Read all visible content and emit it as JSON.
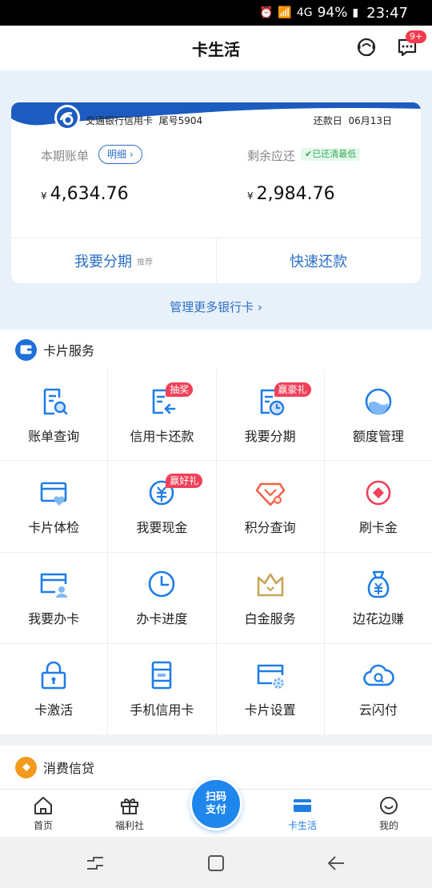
{
  "status_bar": {
    "battery": "94%",
    "time": "23:47",
    "network": "4G"
  },
  "header": {
    "title": "卡生活",
    "message_badge": "9+"
  },
  "card": {
    "bank_name": "交通银行信用卡",
    "tail_label": "尾号5904",
    "due_label": "还款日",
    "due_date": "06月13日",
    "current_bill_label": "本期账单",
    "detail_button": "明细 ›",
    "remaining_label": "剩余应还",
    "paid_status": "✔已还清最低",
    "currency": "¥",
    "current_bill_amount": "4,634.76",
    "remaining_amount": "2,984.76",
    "installment_action": "我要分期",
    "installment_tag": "推荐",
    "quick_pay_action": "快速还款"
  },
  "manage_link": "管理更多银行卡 ›",
  "sections": {
    "card_service": "卡片服务",
    "consumer_credit": "消费信贷"
  },
  "services": [
    {
      "label": "账单查询",
      "icon": "bill-query-icon",
      "tag": ""
    },
    {
      "label": "信用卡还款",
      "icon": "card-repay-icon",
      "tag": "抽奖"
    },
    {
      "label": "我要分期",
      "icon": "installment-icon",
      "tag": "赢豪礼"
    },
    {
      "label": "额度管理",
      "icon": "limit-manage-icon",
      "tag": ""
    },
    {
      "label": "卡片体检",
      "icon": "card-check-icon",
      "tag": ""
    },
    {
      "label": "我要现金",
      "icon": "cash-icon",
      "tag": "赢好礼"
    },
    {
      "label": "积分查询",
      "icon": "points-icon",
      "tag": ""
    },
    {
      "label": "刷卡金",
      "icon": "swipe-gold-icon",
      "tag": ""
    },
    {
      "label": "我要办卡",
      "icon": "apply-card-icon",
      "tag": ""
    },
    {
      "label": "办卡进度",
      "icon": "apply-progress-icon",
      "tag": ""
    },
    {
      "label": "白金服务",
      "icon": "platinum-crown-icon",
      "tag": ""
    },
    {
      "label": "边花边赚",
      "icon": "money-bag-icon",
      "tag": ""
    },
    {
      "label": "卡激活",
      "icon": "lock-icon",
      "tag": ""
    },
    {
      "label": "手机信用卡",
      "icon": "phone-card-icon",
      "tag": ""
    },
    {
      "label": "卡片设置",
      "icon": "card-settings-icon",
      "tag": ""
    },
    {
      "label": "云闪付",
      "icon": "cloud-pay-icon",
      "tag": ""
    }
  ],
  "tabbar": {
    "home": "首页",
    "welfare": "福利社",
    "scan_pay": "扫码\n支付",
    "card_life": "卡生活",
    "mine": "我的"
  },
  "colors": {
    "primary": "#2d6fc7",
    "accent_blue": "#1f7de6",
    "tag_red": "#f0415a",
    "orange": "#f39a1c"
  }
}
